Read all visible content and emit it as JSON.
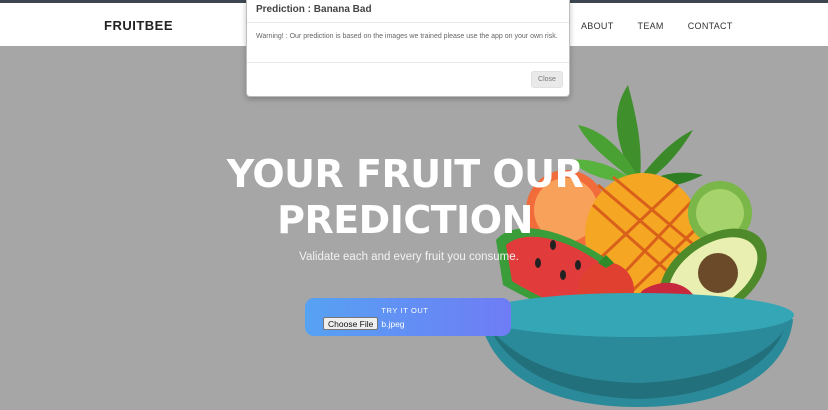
{
  "navbar": {
    "brand": "FRUITBEE",
    "links": [
      "ABOUT",
      "TEAM",
      "CONTACT"
    ]
  },
  "hero": {
    "title_line1": "YOUR FRUIT OUR",
    "title_line2": "PREDICTION",
    "subtitle": "Validate each and every fruit you consume.",
    "cta_label": "TRY IT OUT",
    "file_button": "Choose File",
    "file_name": "b.jpeg"
  },
  "modal": {
    "title": "Prediction : Banana Bad",
    "body": "Warning! : Our prediction is based on the images we trained please use the app on your own risk.",
    "close_label": "Close"
  },
  "colors": {
    "accent_start": "#56a2f3",
    "accent_end": "#6f7cf5",
    "overlay": "#a6a6a6"
  }
}
